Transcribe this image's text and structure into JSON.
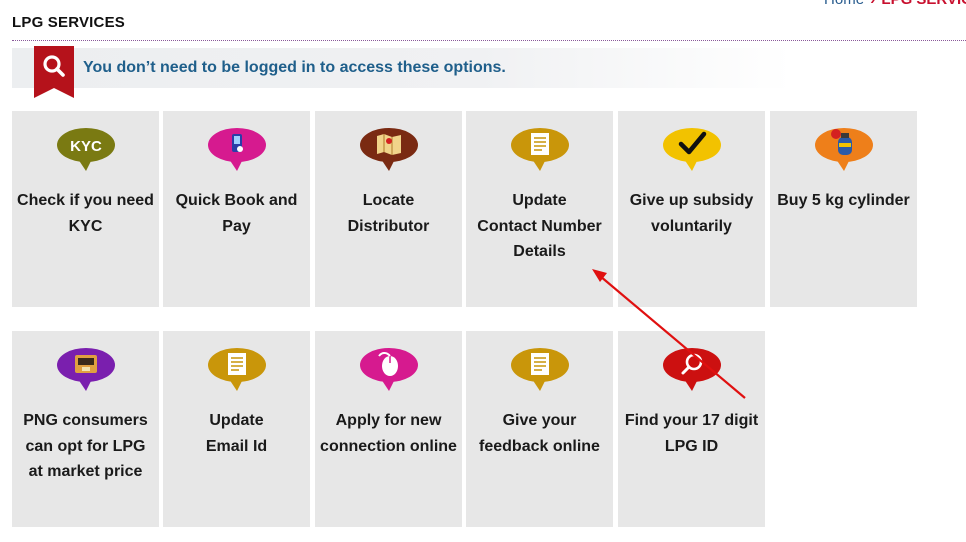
{
  "breadcrumb": {
    "home": "Home",
    "separator": "›",
    "current": "LPG SERVIC"
  },
  "page_title": "LPG SERVICES",
  "notice": {
    "text": "You don’t need to be logged in to access these options.",
    "icon": "search-icon",
    "ribbon_color": "#b5121b"
  },
  "colors": {
    "tile_bg": "#e7e7e7",
    "olive": "#7a7a12",
    "magenta": "#d61a8f",
    "brown": "#7a2a12",
    "gold": "#c9960a",
    "yellow": "#f2c200",
    "orange": "#ee7f1a",
    "purple": "#7a1fae",
    "red": "#cc1010",
    "annotation_arrow": "#e01010"
  },
  "tiles_row1": [
    {
      "label_l1": "Check if you need",
      "label_l2": "KYC",
      "label_l3": "",
      "icon": "kyc-icon",
      "icon_text": "KYC"
    },
    {
      "label_l1": "Quick Book and",
      "label_l2": "Pay",
      "label_l3": "",
      "icon": "book-pay-icon"
    },
    {
      "label_l1": "Locate",
      "label_l2": "Distributor",
      "label_l3": "",
      "icon": "map-icon"
    },
    {
      "label_l1": "Update",
      "label_l2": "Contact Number",
      "label_l3": "Details",
      "icon": "document-icon"
    },
    {
      "label_l1": "Give up subsidy",
      "label_l2": "voluntarily",
      "label_l3": "",
      "icon": "checkmark-icon"
    },
    {
      "label_l1": "Buy 5 kg cylinder",
      "label_l2": "",
      "label_l3": "",
      "icon": "cylinder-icon"
    }
  ],
  "tiles_row2": [
    {
      "label_l1": "PNG consumers",
      "label_l2": "can opt for LPG",
      "label_l3": "at market price",
      "icon": "png-icon"
    },
    {
      "label_l1": "Update",
      "label_l2": "Email Id",
      "label_l3": "",
      "icon": "document-icon"
    },
    {
      "label_l1": "Apply for new",
      "label_l2": "connection online",
      "label_l3": "",
      "icon": "mouse-icon"
    },
    {
      "label_l1": "Give your",
      "label_l2": "feedback online",
      "label_l3": "",
      "icon": "document-icon"
    },
    {
      "label_l1": "Find your 17 digit",
      "label_l2": "LPG ID",
      "label_l3": "",
      "icon": "search-id-icon"
    }
  ]
}
